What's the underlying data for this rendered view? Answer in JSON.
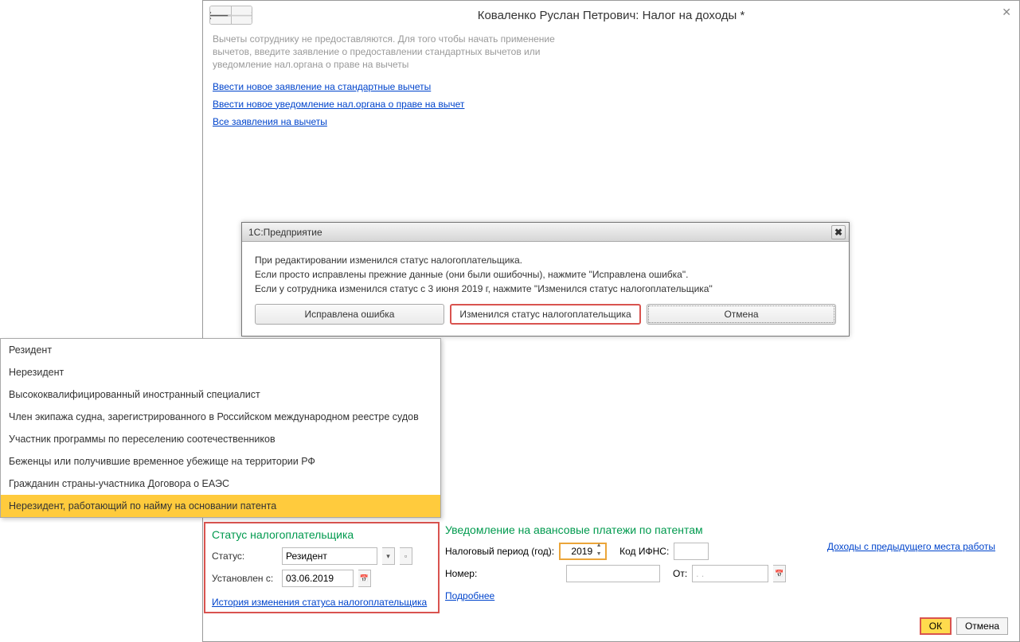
{
  "header": {
    "title": "Коваленко Руслан Петрович: Налог на доходы *"
  },
  "info": {
    "text": "Вычеты сотруднику не предоставляются. Для того чтобы начать применение вычетов, введите заявление о предоставлении стандартных вычетов или уведомление нал.органа о праве на вычеты",
    "link1": "Ввести новое заявление на стандартные вычеты",
    "link2": "Ввести новое уведомление нал.органа о праве на вычет",
    "link3": "Все заявления на вычеты"
  },
  "dialog": {
    "title": "1С:Предприятие",
    "line1": "При редактировании изменился статус налогоплательщика.",
    "line2": "Если просто исправлены прежние данные (они были ошибочны), нажмите \"Исправлена ошибка\".",
    "line3": "Если у сотрудника изменился статус с 3 июня 2019 г, нажмите \"Изменился статус налогоплательщика\"",
    "btn1": "Исправлена ошибка",
    "btn2": "Изменился статус налогоплательщика",
    "btn3": "Отмена"
  },
  "dropdown": {
    "items": [
      "Резидент",
      "Нерезидент",
      "Высококвалифицированный иностранный специалист",
      "Член экипажа судна, зарегистрированного в Российском международном реестре судов",
      "Участник программы по переселению соотечественников",
      "Беженцы или получившие временное убежище на территории РФ",
      "Гражданин страны-участника Договора о ЕАЭС",
      "Нерезидент, работающий по найму на основании патента"
    ]
  },
  "status": {
    "header": "Статус налогоплательщика",
    "status_label": "Статус:",
    "status_value": "Резидент",
    "date_label": "Установлен с:",
    "date_value": "03.06.2019",
    "history_link": "История изменения статуса налогоплательщика"
  },
  "notice": {
    "header": "Уведомление на авансовые платежи по патентам",
    "period_label": "Налоговый период (год):",
    "period_value": "2019",
    "ifns_label": "Код ИФНС:",
    "ifns_value": "",
    "number_label": "Номер:",
    "number_value": "",
    "from_label": "От:",
    "from_value": ".   .",
    "more_link": "Подробнее"
  },
  "right_link": "Доходы с предыдущего места работы",
  "footer": {
    "ok": "ОК",
    "cancel": "Отмена"
  }
}
